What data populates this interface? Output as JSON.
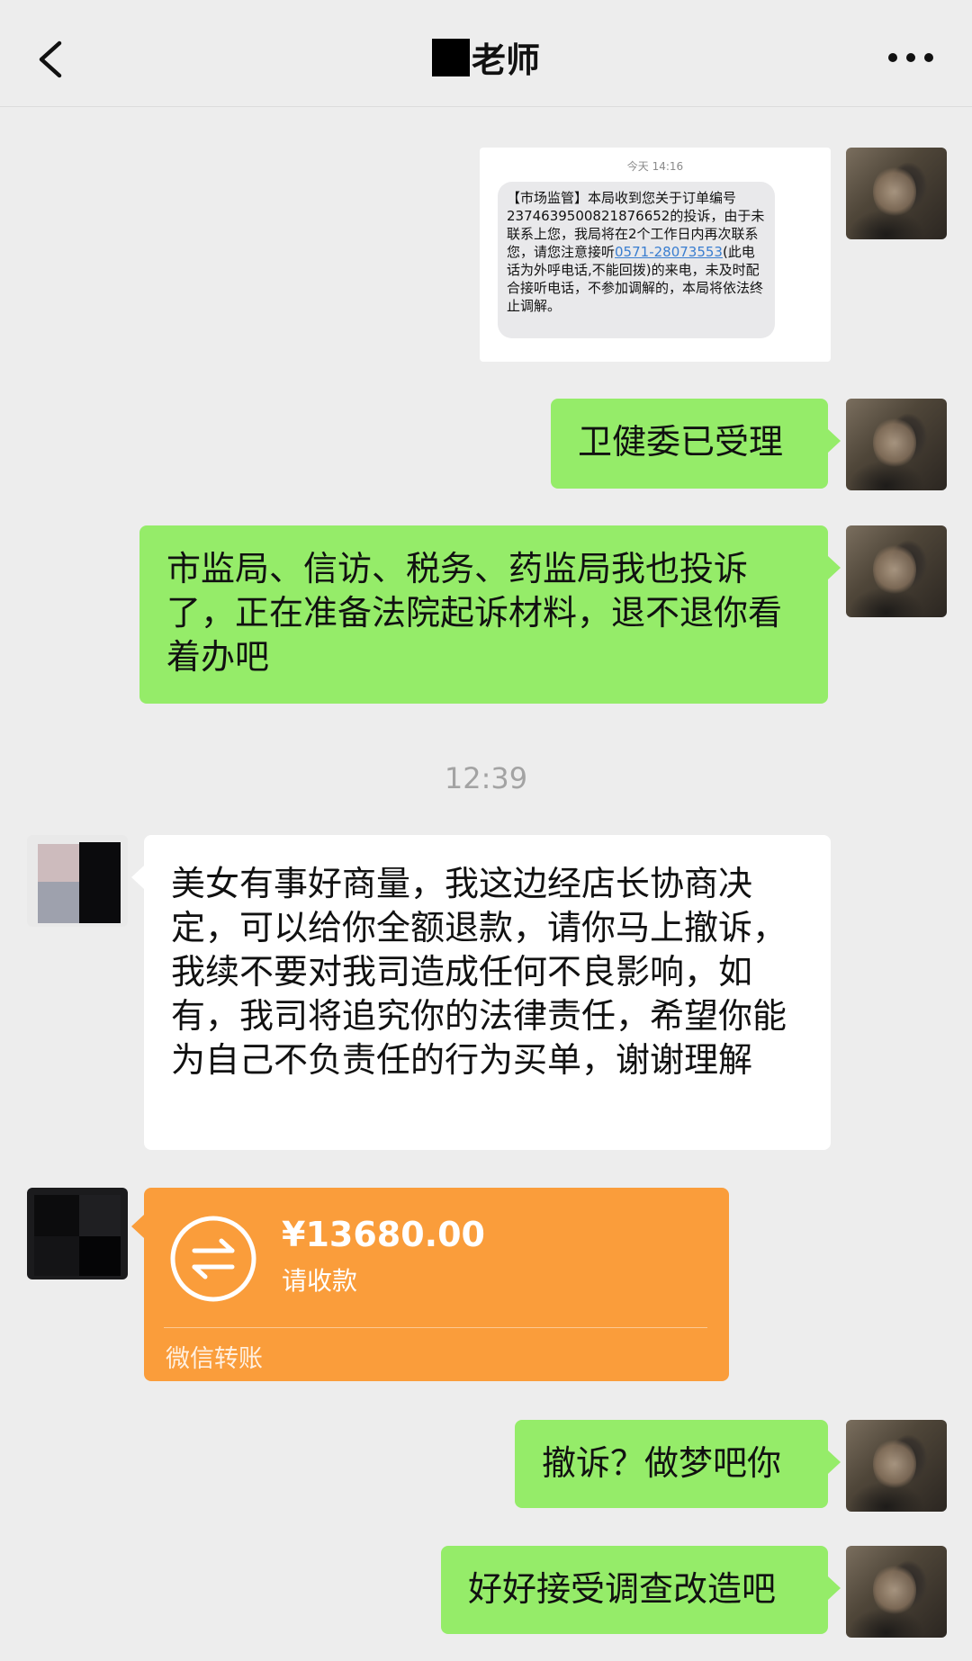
{
  "header": {
    "title": "老师",
    "back_icon": "chevron-left-icon",
    "more_icon": "more-dots-icon"
  },
  "messages": {
    "sms": {
      "time": "今天 14:16",
      "text_before_link": "【市场监管】本局收到您关于订单编号2374639500821876652的投诉，由于未联系上您，我局将在2个工作日内再次联系您，请您注意接听",
      "link": "0571-28073553",
      "text_after_link": "(此电话为外呼电话,不能回拨)的来电，未及时配合接听电话，不参加调解的，本局将依法终止调解。"
    },
    "msg1": "卫健委已受理",
    "msg2": "市监局、信访、税务、药监局我也投诉了，正在准备法院起诉材料，退不退你看着办吧",
    "timestamp": "12:39",
    "msg3": "美女有事好商量，我这边经店长协商决定，可以给你全额退款，请你马上撤诉，我续不要对我司造成任何不良影响，如有，我司将追究你的法律责任，希望你能为自己不负责任的行为买单，谢谢理解",
    "transfer": {
      "amount": "¥13680.00",
      "status": "请收款",
      "type": "微信转账",
      "icon": "transfer-arrows-icon"
    },
    "msg4": "撤诉？做梦吧你",
    "msg5": "好好接受调查改造吧"
  },
  "colors": {
    "sent_bubble": "#95ec69",
    "received_bubble": "#ffffff",
    "transfer_card": "#fa9d3b",
    "background": "#ededed"
  }
}
